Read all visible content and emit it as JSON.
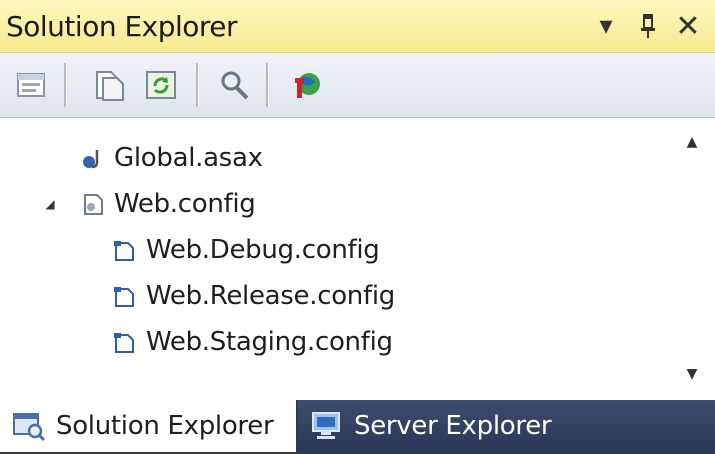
{
  "window": {
    "title": "Solution Explorer",
    "dropdown_glyph": "▾",
    "pin_glyph": "📌",
    "close_glyph": "✕"
  },
  "toolbar": {
    "buttons": [
      {
        "name": "properties-icon"
      },
      {
        "name": "show-all-files-icon"
      },
      {
        "name": "refresh-icon"
      },
      {
        "name": "view-class-diagram-icon"
      },
      {
        "name": "asp-net-configuration-icon"
      }
    ]
  },
  "tree": {
    "items": [
      {
        "label": "Global.asax",
        "icon": "asax-file-icon"
      },
      {
        "label": "Web.config",
        "icon": "config-file-icon",
        "expanded": true
      },
      {
        "label": "Web.Debug.config",
        "icon": "config-transform-icon"
      },
      {
        "label": "Web.Release.config",
        "icon": "config-transform-icon"
      },
      {
        "label": "Web.Staging.config",
        "icon": "config-transform-icon"
      }
    ],
    "expander_glyph": "◢",
    "scroll_up_glyph": "▲",
    "scroll_down_glyph": "▼"
  },
  "tabs": [
    {
      "label": "Solution Explorer",
      "active": true,
      "icon": "solution-explorer-icon"
    },
    {
      "label": "Server Explorer",
      "active": false,
      "icon": "server-explorer-icon"
    }
  ],
  "colors": {
    "title_bar": "#f6e98e",
    "tab_strip": "#2b3a55",
    "tree_background": "#ffffff"
  }
}
